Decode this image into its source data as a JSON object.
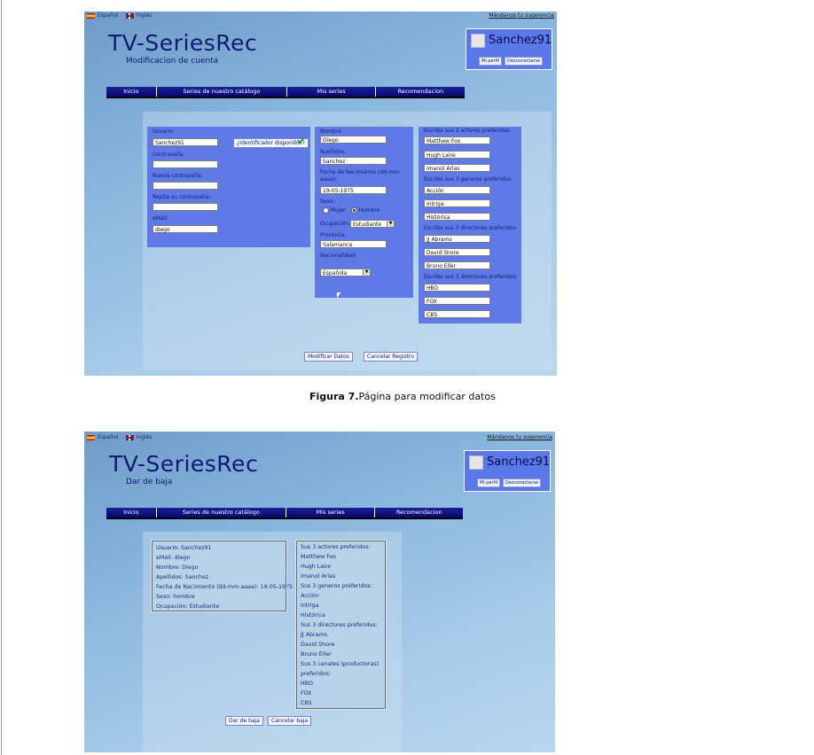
{
  "lang": {
    "es": "Español",
    "en": "Inglés"
  },
  "suggestion_link": "Mándanos tu sugerencia",
  "app_title": "TV-SeriesRec",
  "user": {
    "name": "Sanchez91",
    "profile_btn": "Mi perfil",
    "logout_btn": "Desconectarse"
  },
  "nav": [
    "Inicio",
    "Series de nuestro catálogo",
    "Mis series",
    "Recomendacion"
  ],
  "screen1": {
    "subtitle": "Modificacion de cuenta",
    "account": {
      "usuario_label": "Usuario:",
      "usuario_value": "Sanchez91",
      "id_check_btn": "¿Identificador disponible?",
      "password_label": "Contraseña:",
      "new_password_label": "Nueva contraseña:",
      "repeat_password_label": "Repita su contraseña:",
      "email_label": "eMail:",
      "email_value": "diego"
    },
    "personal": {
      "nombre_label": "Nombre:",
      "nombre_value": "Diego",
      "apellidos_label": "Apellidos:",
      "apellidos_value": "Sanchez",
      "fecha_label": "Fecha de Nacimiento (dd-mm-aaaa):",
      "fecha_value": "19-05-1975",
      "sexo_label": "Sexo:",
      "mujer": "Mujer",
      "hombre": "Hombre",
      "ocupacion_label": "Ocupación:",
      "ocupacion_value": "Estudiante",
      "provincia_label": "Provincia:",
      "provincia_value": "Salamanca",
      "nacionalidad_label": "Nacionalidad:",
      "nacionalidad_value": "Española"
    },
    "prefs": {
      "actores_label": "Escriba sus 3 actores preferidos:",
      "actores": [
        "Matthew Fox",
        "Hugh Laire",
        "Imanol Arias"
      ],
      "generos_label": "Escriba sus 3 generos preferidos:",
      "generos": [
        "Acción",
        "Intriga",
        "Histórica"
      ],
      "directores_label": "Escriba sus 3 directores preferidos:",
      "directores": [
        "JJ Abrams",
        "David Shore",
        "Bruno Eller"
      ],
      "canales_label": "Escriba sus 3 directores preferidos:",
      "canales": [
        "HBO",
        "FOX",
        "CBS"
      ]
    },
    "modify_btn": "Modificar Datos",
    "cancel_btn": "Cancelar Registro"
  },
  "caption": {
    "prefix": "Figura 7.",
    "text": "Página para modificar datos"
  },
  "screen2": {
    "subtitle": "Dar de baja",
    "left_lines": [
      "Usuario: Sanchez91",
      "eMail: diego",
      "Nombre: Diego",
      "Apellidos: Sanchez",
      "Fecha de Nacimiento (dd-mm-aaaa): 19-05-1975",
      "Sexo: hombre",
      "Ocupación: Estudiante"
    ],
    "right_lines": [
      "Sus 3 actores preferidos:",
      "Matthew Fox",
      "Hugh Laire",
      "Imanol Arias",
      "Sus 3 generos preferidos:",
      "Acción",
      "Intriga",
      "Histórica",
      "Sus 3 directores preferidos:",
      "JJ Abrams",
      "David Shore",
      "Bruno Eller",
      "Sus 3 canales (productoras)",
      "preferidos:",
      "HBO",
      "FOX",
      "CBS"
    ],
    "baja_btn": "Dar de baja",
    "cancel_btn": "Cancelar baja"
  }
}
